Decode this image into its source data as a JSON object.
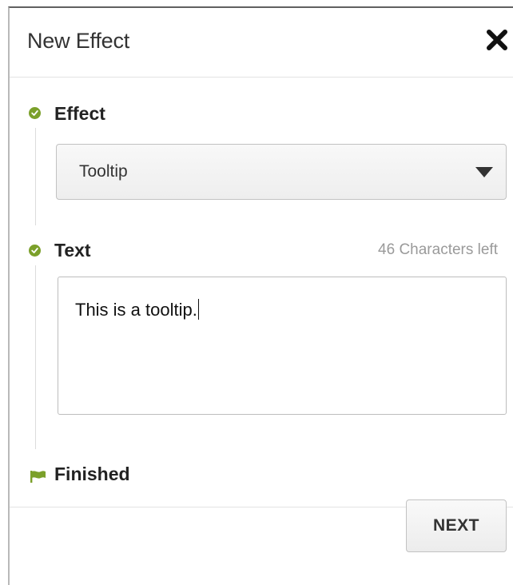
{
  "dialog": {
    "title": "New Effect",
    "close_icon": "close-icon"
  },
  "steps": {
    "effect": {
      "label": "Effect",
      "status_icon": "check-circle-icon",
      "select_value": "Tooltip",
      "select_icon": "caret-down-icon"
    },
    "text": {
      "label": "Text",
      "status_icon": "check-circle-icon",
      "chars_left": "46 Characters left",
      "value": "This is a tooltip."
    },
    "finished": {
      "label": "Finished",
      "status_icon": "flag-icon"
    }
  },
  "footer": {
    "next_label": "NEXT"
  },
  "colors": {
    "accent_green": "#7ba02a"
  }
}
